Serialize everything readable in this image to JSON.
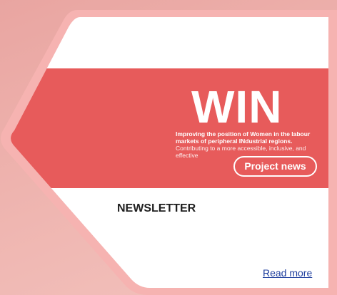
{
  "banner": {
    "title": "WIN",
    "tagline_bold": "Improving the position of Women in the labour markets of peripheral INdustrial regions.",
    "tagline_light": "Contributing to a more accessible, inclusive, and effective",
    "button_label": "Project news",
    "color": "#e75b5b"
  },
  "section": {
    "heading": "NEWSLETTER"
  },
  "footer": {
    "link_label": "Read more",
    "link_color": "#1f3f9e"
  },
  "colors": {
    "background": "#eeaeaa",
    "frame": "#f6b3b1",
    "card": "#ffffff"
  }
}
